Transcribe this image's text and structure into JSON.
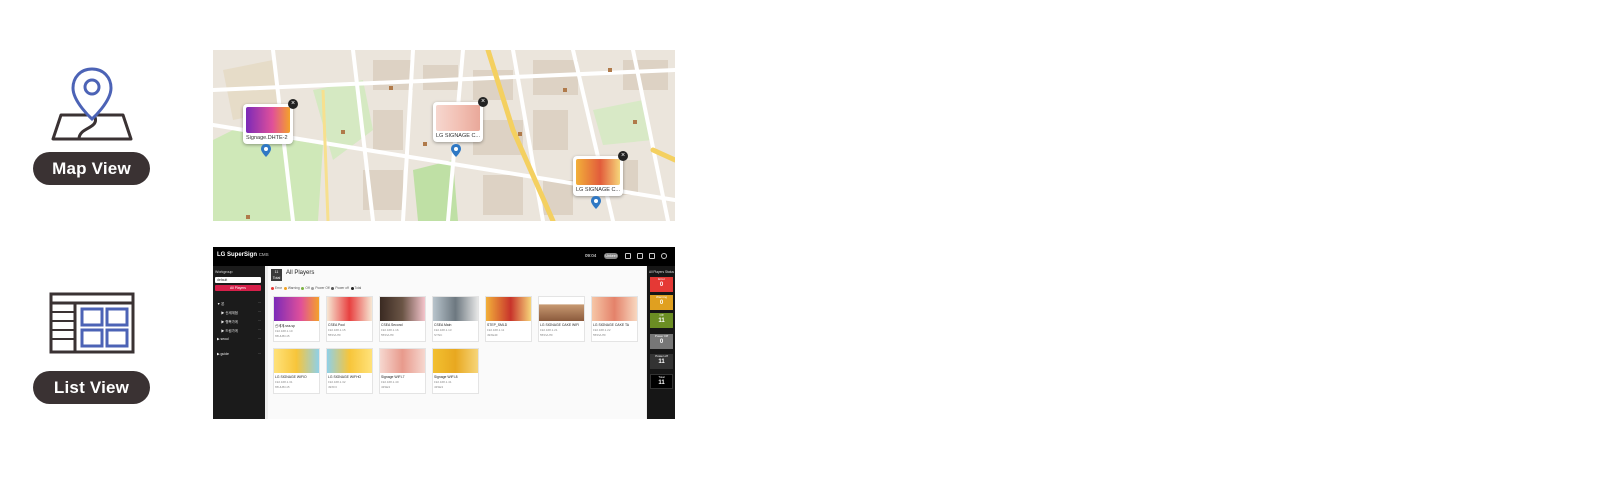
{
  "features": {
    "map_view": {
      "label": "Map View",
      "icon": "map-pin-icon"
    },
    "list_view": {
      "label": "List View",
      "icon": "grid-list-icon"
    }
  },
  "map": {
    "popups": [
      {
        "caption": "Signage.DHTE-2"
      },
      {
        "caption": "LG SIGNAGE C..."
      },
      {
        "caption": "LG SIGNAGE C..."
      }
    ],
    "marker_color": "#2f78c4"
  },
  "app": {
    "brand": "LG SuperSign",
    "brand_suffix": "CMS",
    "clock": "09:04",
    "badge": "Unkeel",
    "sidebar": {
      "label": "Workgroup",
      "select_value": "default",
      "all_players": "All Players",
      "items": [
        "▼ 본",
        "▶ 신세계점",
        "▶ 행복가게",
        "▶ 드림가게",
        "▶ seoul",
        "▶ guide"
      ]
    },
    "content": {
      "count_label": "11",
      "count_sub": "Total",
      "title": "All Players",
      "legend": [
        "Error",
        "Warning",
        "Off",
        "Power Off",
        "Power off",
        "Total"
      ],
      "legend_colors": [
        "#e53935",
        "#f0a020",
        "#7cb342",
        "#9e9e9e",
        "#555555",
        "#222222"
      ],
      "cards": [
        {
          "name": "신세계.sss.sp",
          "ip": "192.168.1.10",
          "model": "65UH5C-B"
        },
        {
          "name": "CSEA Pool",
          "ip": "192.168.1.15",
          "model": "55SVH7F"
        },
        {
          "name": "CSEA Second",
          "ip": "192.168.1.16",
          "model": "55SVH7F"
        },
        {
          "name": "CSEA Main",
          "ip": "192.168.1.13",
          "model": "SYNC"
        },
        {
          "name": "STEP_SMLD",
          "ip": "192.168.1.11",
          "model": "49XE4F"
        },
        {
          "name": "LG SIGNAGE CAKE WIFI",
          "ip": "192.168.1.21",
          "model": "55SVH7F"
        },
        {
          "name": "LG SIGNAGE CAKE TA",
          "ip": "192.168.1.22",
          "model": "55SVH7F"
        },
        {
          "name": "LG SIGNAGE WIFIO",
          "ip": "192.168.1.31",
          "model": "65UH5C-B"
        },
        {
          "name": "LG SIGNAGE WIFHO",
          "ip": "192.168.1.32",
          "model": "49XF3"
        },
        {
          "name": "Signage WIFI-7",
          "ip": "192.168.1.40",
          "model": "43SE3"
        },
        {
          "name": "Signage WIFI-8",
          "ip": "192.168.1.41",
          "model": "43SE3"
        }
      ]
    },
    "status": {
      "title": "All Players Status",
      "boxes": [
        {
          "label": "Error",
          "value": "0",
          "color": "#e53935"
        },
        {
          "label": "Warning",
          "value": "0",
          "color": "#e0a020"
        },
        {
          "label": "Off",
          "value": "11",
          "color": "#6b8e23"
        },
        {
          "label": "Power Off",
          "value": "0",
          "color": "#777777"
        },
        {
          "label": "Power off",
          "value": "11",
          "color": "#333333"
        },
        {
          "label": "Total",
          "value": "11",
          "color": "#000000"
        }
      ]
    }
  }
}
